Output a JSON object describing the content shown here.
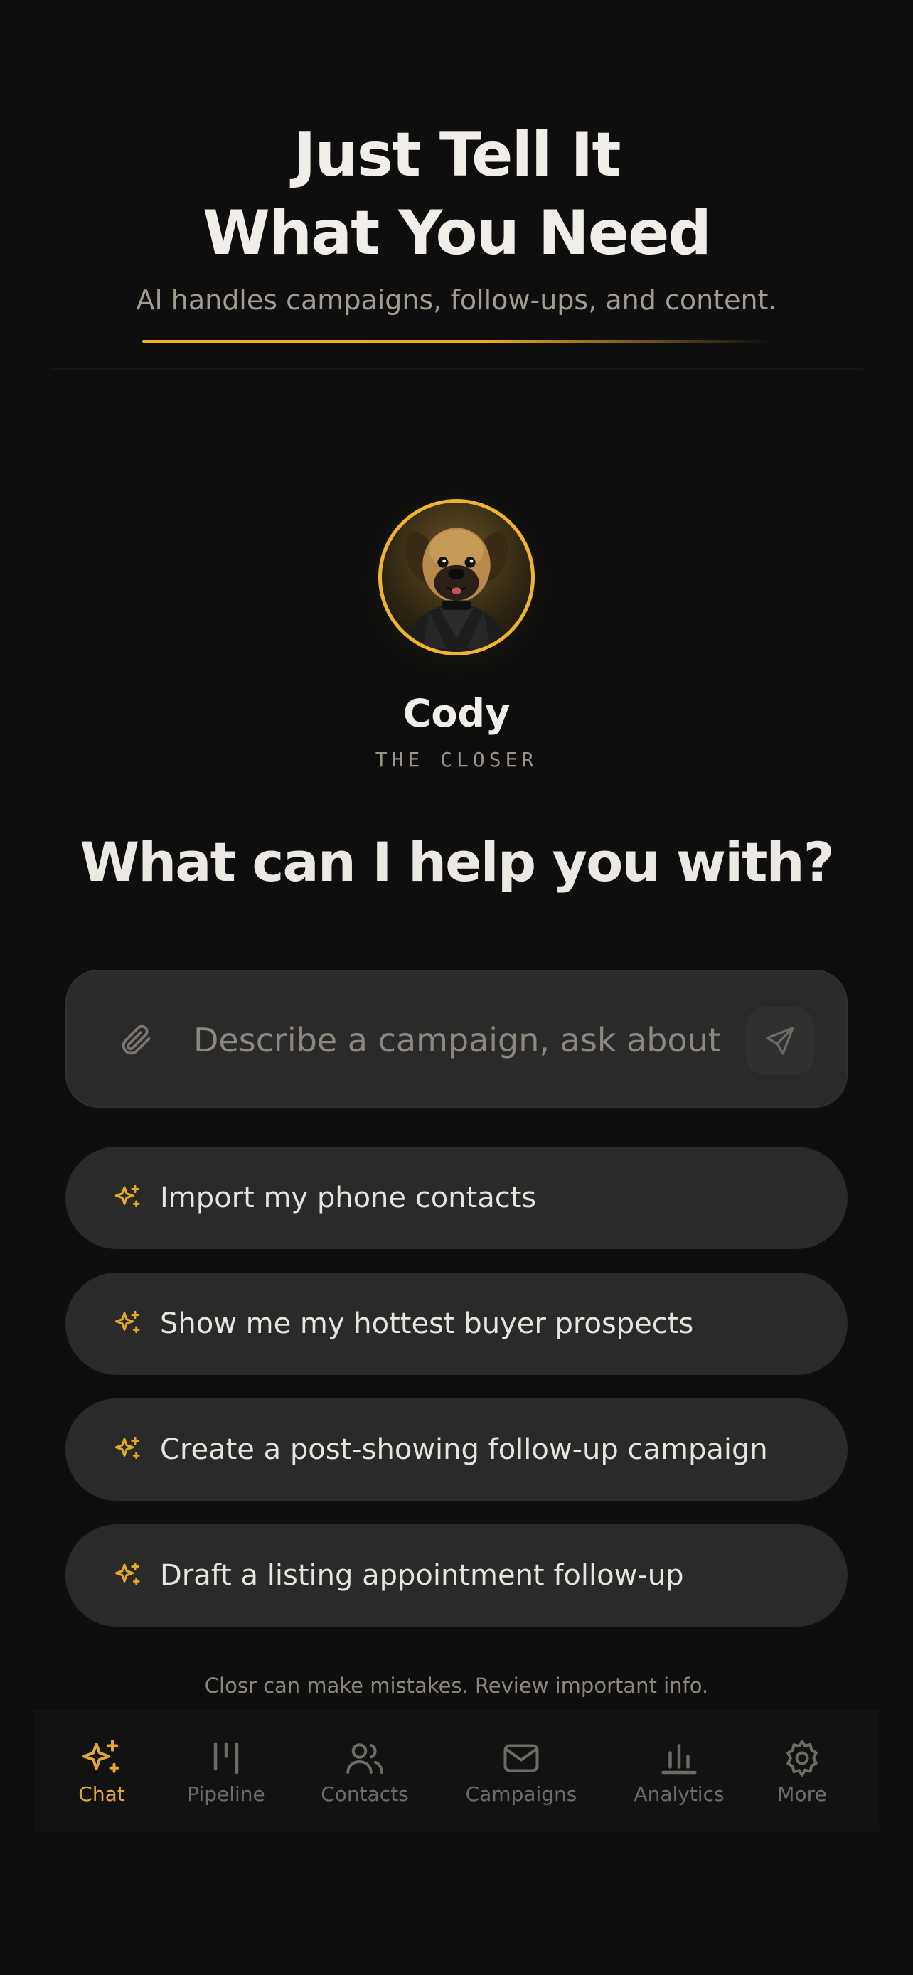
{
  "hero": {
    "title_line1": "Just Tell It",
    "title_line2": "What You Need",
    "subtitle": "AI handles campaigns, follow-ups, and content."
  },
  "agent": {
    "name": "Cody",
    "role": "THE CLOSER",
    "avatar_icon": "dog-avatar"
  },
  "prompt_heading": "What can I help you with?",
  "input": {
    "placeholder": "Describe a campaign, ask about",
    "value": ""
  },
  "suggestions": [
    {
      "label": "Import my phone contacts"
    },
    {
      "label": "Show me my hottest buyer prospects"
    },
    {
      "label": "Create a post-showing follow-up campaign"
    },
    {
      "label": "Draft a listing appointment follow-up"
    }
  ],
  "disclaimer": "Closr can make mistakes. Review important info.",
  "nav": {
    "items": [
      {
        "label": "Chat",
        "icon": "sparkle-icon",
        "active": true
      },
      {
        "label": "Pipeline",
        "icon": "pipeline-icon",
        "active": false
      },
      {
        "label": "Contacts",
        "icon": "contacts-icon",
        "active": false
      },
      {
        "label": "Campaigns",
        "icon": "mail-icon",
        "active": false
      },
      {
        "label": "Analytics",
        "icon": "bar-chart-icon",
        "active": false
      },
      {
        "label": "More",
        "icon": "gear-icon",
        "active": false
      }
    ]
  },
  "colors": {
    "background": "#0e0e0e",
    "accent": "#f0b233",
    "card": "#2a2a2a",
    "muted": "#8d877e"
  }
}
